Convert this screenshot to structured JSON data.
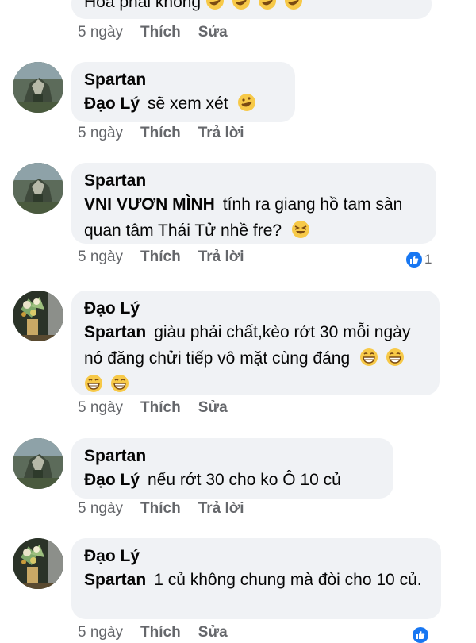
{
  "comments": [
    {
      "author": "",
      "mention": "",
      "text": "Hoà phải không",
      "emoji": [
        "rofl-emoji",
        "rofl-emoji",
        "rofl-emoji",
        "rofl-emoji"
      ],
      "time": "5 ngày",
      "like_label": "Thích",
      "action_label": "Sửa"
    },
    {
      "author": "Spartan",
      "mention": "Đạo Lý",
      "text": "sẽ xem xét",
      "emoji": [
        "rofl-emoji"
      ],
      "time": "5 ngày",
      "like_label": "Thích",
      "action_label": "Trả lời"
    },
    {
      "author": "Spartan",
      "mention": "VNI VƯƠN MÌNH",
      "text": "tính ra giang hồ tam sàn quan tâm Thái Tử nhề fre?",
      "emoji": [
        "grin-squint-emoji"
      ],
      "time": "5 ngày",
      "like_label": "Thích",
      "action_label": "Trả lời",
      "reaction_count": "1"
    },
    {
      "author": "Đạo Lý",
      "mention": "Spartan",
      "text": "giàu phải chất,kèo rớt 30 mỗi ngày nó đăng chửi tiếp vô mặt cùng đáng",
      "emoji": [
        "grin-emoji",
        "grin-emoji",
        "grin-emoji",
        "grin-emoji"
      ],
      "time": "5 ngày",
      "like_label": "Thích",
      "action_label": "Sửa"
    },
    {
      "author": "Spartan",
      "mention": "Đạo Lý",
      "text": "nếu rớt 30 cho ko Ô 10 củ",
      "emoji": [],
      "time": "5 ngày",
      "like_label": "Thích",
      "action_label": "Trả lời"
    },
    {
      "author": "Đạo Lý",
      "mention": "Spartan",
      "text": "1 củ không chung mà đòi cho 10 củ.",
      "emoji": [],
      "time": "5 ngày",
      "like_label": "Thích",
      "action_label": "Sửa"
    }
  ],
  "colors": {
    "bubble": "#f0f2f5",
    "meta_text": "#65676b",
    "like_blue": "#1877f2"
  }
}
